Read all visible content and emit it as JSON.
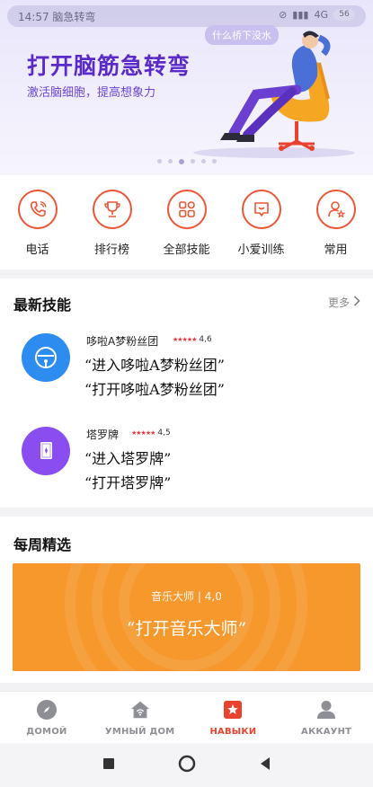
{
  "status": {
    "left_text": "14:57 脑急转弯",
    "network": "4G",
    "battery": "56"
  },
  "banner": {
    "title": "打开脑筋急转弯",
    "subtitle": "激活脑细胞，提高想象力",
    "bubble": "什么桥下没水",
    "dots": 6,
    "active_dot": 2
  },
  "quick_actions": [
    {
      "label": "电话",
      "icon": "phone-icon"
    },
    {
      "label": "排行榜",
      "icon": "trophy-icon"
    },
    {
      "label": "全部技能",
      "icon": "grid-icon"
    },
    {
      "label": "小爱训练",
      "icon": "chat-train-icon"
    },
    {
      "label": "常用",
      "icon": "user-star-icon"
    }
  ],
  "latest": {
    "title": "最新技能",
    "more": "更多",
    "skills": [
      {
        "name": "哆啦A梦粉丝团",
        "rating": "4,6",
        "phrases": [
          "“进入哆啦A梦粉丝团”",
          "“打开哆啦A梦粉丝团”"
        ],
        "color": "#2d8cf0"
      },
      {
        "name": "塔罗牌",
        "rating": "4,5",
        "phrases": [
          "“进入塔罗牌”",
          "“打开塔罗牌”"
        ],
        "color": "#8a4df0"
      }
    ]
  },
  "weekly": {
    "title": "每周精选",
    "skill_meta": "音乐大师 | 4,0",
    "phrase": "“打开音乐大师”"
  },
  "nav": [
    {
      "label": "ДОМОЙ",
      "icon": "compass-icon",
      "active": false
    },
    {
      "label": "УМНЫЙ ДОМ",
      "icon": "smart-home-icon",
      "active": false
    },
    {
      "label": "НАВЫКИ",
      "icon": "skills-star-icon",
      "active": true
    },
    {
      "label": "АККАУНТ",
      "icon": "account-icon",
      "active": false
    }
  ],
  "colors": {
    "accent": "#ee5536",
    "nav_active": "#e8432f",
    "banner_title": "#5a2bc9",
    "weekly_card": "#f6982c"
  }
}
